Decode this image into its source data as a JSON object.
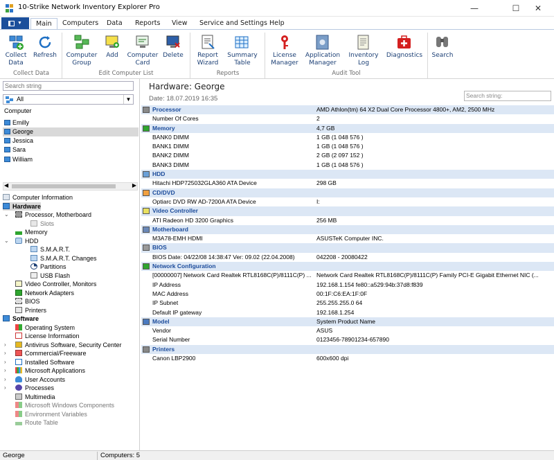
{
  "window": {
    "title": "10-Strike Network Inventory Explorer Pro",
    "minimize": "—",
    "maximize": "☐",
    "close": "✕"
  },
  "tabs": [
    {
      "label": "Main"
    },
    {
      "label": "Computers"
    },
    {
      "label": "Data"
    },
    {
      "label": "Reports"
    },
    {
      "label": "View"
    },
    {
      "label": "Service and Settings"
    },
    {
      "label": "Help"
    }
  ],
  "ribbon": {
    "collect_data": "Collect\nData",
    "refresh": "Refresh",
    "computer_group": "Computer\nGroup",
    "add": "Add",
    "computer_card": "Computer\nCard",
    "delete": "Delete",
    "report_wizard": "Report\nWizard",
    "summary_table": "Summary\nTable",
    "license_manager": "License\nManager",
    "application_manager": "Application\nManager",
    "inventory_log": "Inventory\nLog",
    "diagnostics": "Diagnostics",
    "search": "Search",
    "groups": {
      "collect": "Collect Data",
      "edit": "Edit Computer List",
      "reports": "Reports",
      "audit": "Audit Tool"
    }
  },
  "left": {
    "search_placeholder": "Search string",
    "filter_value": "All",
    "computer_header": "Computer",
    "computers": [
      "Emilly",
      "George",
      "Jessica",
      "Sara",
      "William"
    ],
    "tree": {
      "computer_information": "Computer Information",
      "hardware": "Hardware",
      "processor": "Processor, Motherboard",
      "slots": "Slots",
      "memory": "Memory",
      "hdd": "HDD",
      "smart": "S.M.A.R.T.",
      "smart_changes": "S.M.A.R.T. Changes",
      "partitions": "Partitions",
      "usb_flash": "USB Flash",
      "video": "Video Controller, Monitors",
      "network": "Network Adapters",
      "bios": "BIOS",
      "printers": "Printers",
      "software": "Software",
      "os": "Operating System",
      "license": "License Information",
      "antivirus": "Antivirus Software, Security Center",
      "commercial": "Commercial/Freeware",
      "installed": "Installed Software",
      "microsoft_apps": "Microsoft Applications",
      "user_accounts": "User Accounts",
      "processes": "Processes",
      "multimedia": "Multimedia",
      "ms_components": "Microsoft Windows Components",
      "env_vars": "Environment Variables",
      "route_table": "Route Table"
    }
  },
  "right": {
    "title": "Hardware: George",
    "date": "Date: 18.07.2019 16:35",
    "search_placeholder": "Search string:",
    "rows": [
      {
        "k": "Processor",
        "v": "AMD Athlon(tm) 64 X2 Dual Core Processor 4800+, AM2, 2500 MHz",
        "sec": true,
        "icon": "cpu"
      },
      {
        "k": "Number Of Cores",
        "v": "2"
      },
      {
        "k": "Memory",
        "v": "4,7 GB",
        "sec": true,
        "icon": "memory"
      },
      {
        "k": "BANK0 DIMM",
        "v": "1 GB (1 048 576 )"
      },
      {
        "k": "BANK1 DIMM",
        "v": "1 GB (1 048 576 )"
      },
      {
        "k": "BANK2 DIMM",
        "v": "2 GB (2 097 152 )"
      },
      {
        "k": "BANK3 DIMM",
        "v": "1 GB (1 048 576 )"
      },
      {
        "k": "HDD",
        "v": "",
        "sec": true,
        "icon": "hdd"
      },
      {
        "k": "Hitachi HDP725032GLA360 ATA Device",
        "v": "298 GB"
      },
      {
        "k": "CD/DVD",
        "v": "",
        "sec": true,
        "icon": "cd"
      },
      {
        "k": "Optiarc DVD RW AD-7200A ATA Device",
        "v": "I:"
      },
      {
        "k": "Video Controller",
        "v": "",
        "sec": true,
        "icon": "video"
      },
      {
        "k": "ATI Radeon HD 3200 Graphics",
        "v": "256 MB"
      },
      {
        "k": "Motherboard",
        "v": "",
        "sec": true,
        "icon": "board"
      },
      {
        "k": "M3A78-EMH HDMI",
        "v": "ASUSTeK Computer INC."
      },
      {
        "k": "BIOS",
        "v": "",
        "sec": true,
        "icon": "bios"
      },
      {
        "k": "BIOS Date: 04/22/08 14:38:47 Ver: 09.02 (22.04.2008)",
        "v": "042208 - 20080422"
      },
      {
        "k": "Network Configuration",
        "v": "",
        "sec": true,
        "icon": "network"
      },
      {
        "k": "[00000007] Network Card Realtek RTL8168C(P)/8111C(P) ...",
        "v": "Network Card Realtek RTL8168C(P)/8111C(P) Family PCI-E Gigabit Ethernet NIC (..."
      },
      {
        "k": "IP Address",
        "v": "192.168.1.154 fe80::a529:94b:37d8:f839"
      },
      {
        "k": "MAC Address",
        "v": "00:1F:C6:EA:1F:0F"
      },
      {
        "k": "IP Subnet",
        "v": "255.255.255.0 64"
      },
      {
        "k": "Default IP gateway",
        "v": "192.168.1.254"
      },
      {
        "k": "Model",
        "v": "System Product Name",
        "sec": true,
        "icon": "model"
      },
      {
        "k": "Vendor",
        "v": "ASUS"
      },
      {
        "k": "Serial Number",
        "v": "0123456-78901234-657890"
      },
      {
        "k": "Printers",
        "v": "",
        "sec": true,
        "icon": "printer"
      },
      {
        "k": "Canon LBP2900",
        "v": "600x600 dpi"
      }
    ]
  },
  "status": {
    "computer": "George",
    "count": "Computers: 5"
  },
  "colors": {
    "accent": "#1b4f9b",
    "section": "#dce7f5",
    "section_text": "#1b4b9b"
  }
}
